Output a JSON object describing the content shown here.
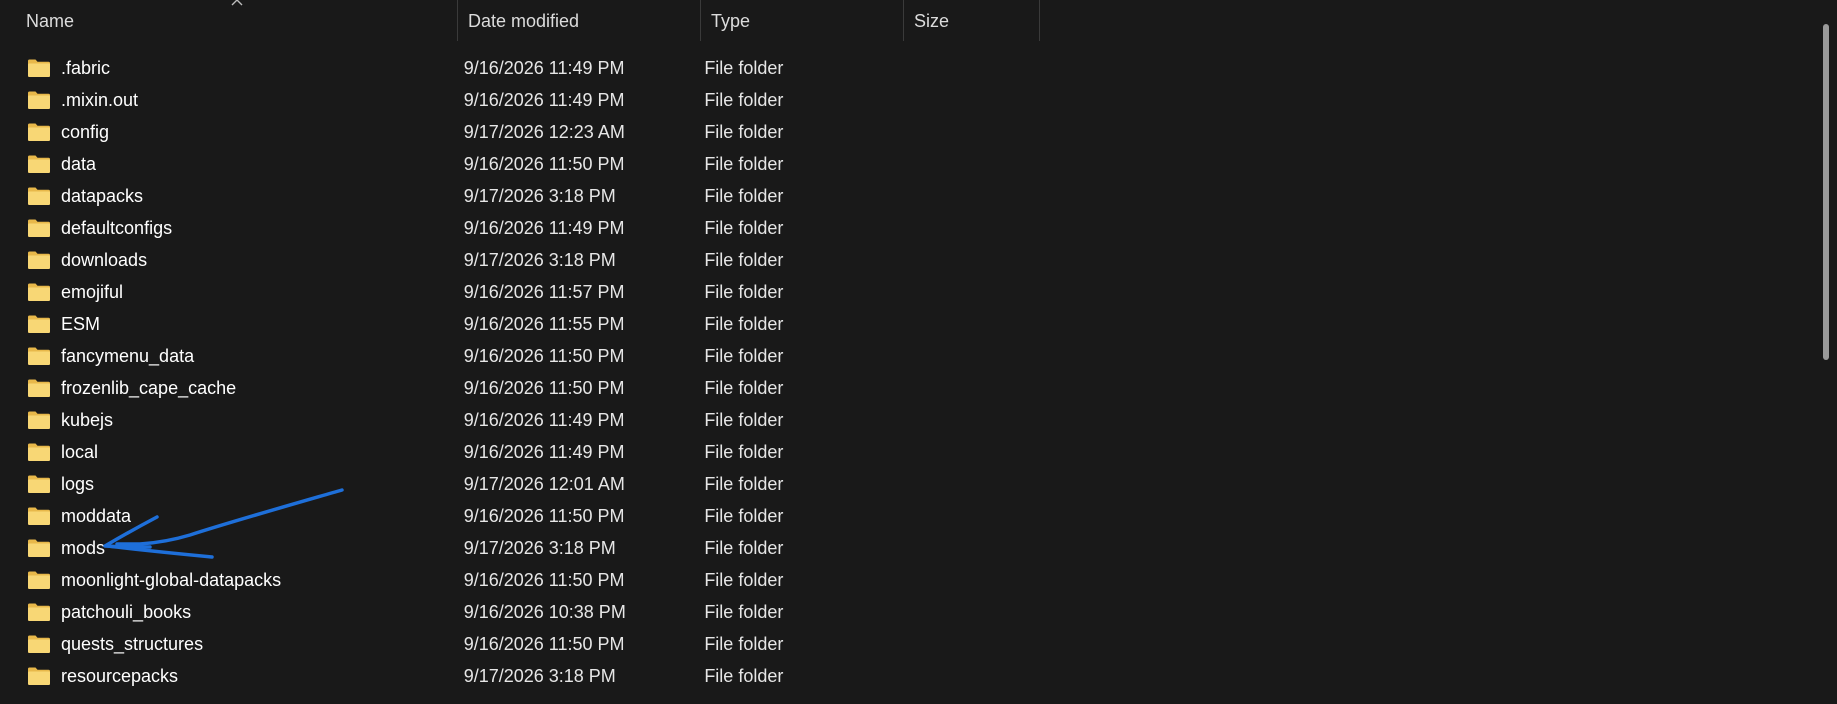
{
  "columns": {
    "name": "Name",
    "date": "Date modified",
    "type": "Type",
    "size": "Size"
  },
  "icons": {
    "folder": "folder-icon",
    "sort": "chevron-up-icon"
  },
  "colors": {
    "background": "#191919",
    "folder_front": "#f8d775",
    "folder_back": "#e8b84a",
    "annotation": "#1e6fd9"
  },
  "files": [
    {
      "name": ".fabric",
      "date": "9/16/2026 11:49 PM",
      "type": "File folder",
      "size": ""
    },
    {
      "name": ".mixin.out",
      "date": "9/16/2026 11:49 PM",
      "type": "File folder",
      "size": ""
    },
    {
      "name": "config",
      "date": "9/17/2026 12:23 AM",
      "type": "File folder",
      "size": ""
    },
    {
      "name": "data",
      "date": "9/16/2026 11:50 PM",
      "type": "File folder",
      "size": ""
    },
    {
      "name": "datapacks",
      "date": "9/17/2026 3:18 PM",
      "type": "File folder",
      "size": ""
    },
    {
      "name": "defaultconfigs",
      "date": "9/16/2026 11:49 PM",
      "type": "File folder",
      "size": ""
    },
    {
      "name": "downloads",
      "date": "9/17/2026 3:18 PM",
      "type": "File folder",
      "size": ""
    },
    {
      "name": "emojiful",
      "date": "9/16/2026 11:57 PM",
      "type": "File folder",
      "size": ""
    },
    {
      "name": "ESM",
      "date": "9/16/2026 11:55 PM",
      "type": "File folder",
      "size": ""
    },
    {
      "name": "fancymenu_data",
      "date": "9/16/2026 11:50 PM",
      "type": "File folder",
      "size": ""
    },
    {
      "name": "frozenlib_cape_cache",
      "date": "9/16/2026 11:50 PM",
      "type": "File folder",
      "size": ""
    },
    {
      "name": "kubejs",
      "date": "9/16/2026 11:49 PM",
      "type": "File folder",
      "size": ""
    },
    {
      "name": "local",
      "date": "9/16/2026 11:49 PM",
      "type": "File folder",
      "size": ""
    },
    {
      "name": "logs",
      "date": "9/17/2026 12:01 AM",
      "type": "File folder",
      "size": ""
    },
    {
      "name": "moddata",
      "date": "9/16/2026 11:50 PM",
      "type": "File folder",
      "size": ""
    },
    {
      "name": "mods",
      "date": "9/17/2026 3:18 PM",
      "type": "File folder",
      "size": ""
    },
    {
      "name": "moonlight-global-datapacks",
      "date": "9/16/2026 11:50 PM",
      "type": "File folder",
      "size": ""
    },
    {
      "name": "patchouli_books",
      "date": "9/16/2026 10:38 PM",
      "type": "File folder",
      "size": ""
    },
    {
      "name": "quests_structures",
      "date": "9/16/2026 11:50 PM",
      "type": "File folder",
      "size": ""
    },
    {
      "name": "resourcepacks",
      "date": "9/17/2026 3:18 PM",
      "type": "File folder",
      "size": ""
    }
  ]
}
